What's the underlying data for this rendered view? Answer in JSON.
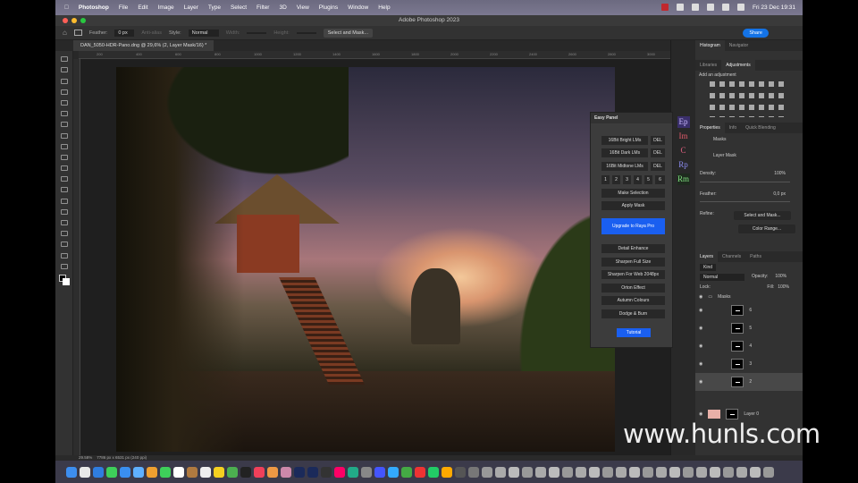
{
  "menubar": {
    "app": "Photoshop",
    "items": [
      "File",
      "Edit",
      "Image",
      "Layer",
      "Type",
      "Select",
      "Filter",
      "3D",
      "View",
      "Plugins",
      "Window",
      "Help"
    ],
    "clock": "Fri 23 Dec  19:31"
  },
  "window": {
    "title": "Adobe Photoshop 2023"
  },
  "options": {
    "feather_label": "Feather:",
    "feather_value": "0 px",
    "anti_alias": "Anti-alias",
    "style_label": "Style:",
    "style_value": "Normal",
    "width_label": "Width:",
    "height_label": "Height:",
    "select_mask": "Select and Mask...",
    "share": "Share"
  },
  "document": {
    "tab": "DAN_5050-HDR-Pano.dng @ 29,6% (2, Layer Mask/16) *",
    "zoom": "29.58%",
    "info": "7786 px x 6531 px (240 ppi)"
  },
  "ruler_ticks": [
    "200",
    "400",
    "600",
    "800",
    "1000",
    "1200",
    "1400",
    "1600",
    "1800",
    "2000",
    "2200",
    "2400",
    "2600",
    "2800",
    "3000"
  ],
  "side_icons": [
    "Ep",
    "Im",
    "C",
    "Rp",
    "Rm"
  ],
  "easy_panel": {
    "title": "Easy Panel",
    "rows": [
      {
        "label": "16Bit Bright LMs",
        "del": "DEL"
      },
      {
        "label": "16Bit Dark LMs",
        "del": "DEL"
      },
      {
        "label": "16Bit Midtone LMs",
        "del": "DEL"
      }
    ],
    "numbers": [
      "1",
      "2",
      "3",
      "4",
      "5",
      "6"
    ],
    "make_selection": "Make Selection",
    "apply_mask": "Apply Mask",
    "upgrade": "Upgrade to Raya Pro",
    "actions": [
      "Detail Enhance",
      "Sharpen Full Size",
      "Sharpen For Web 2048px",
      "Orton Effect",
      "Autumn Colours",
      "Dodge & Burn"
    ],
    "tutorial": "Tutorial"
  },
  "panels": {
    "tabs1": [
      "Histogram",
      "Navigator"
    ],
    "tabs2": [
      "Libraries",
      "Adjustments"
    ],
    "add_adjustment": "Add an adjustment",
    "tabs3": [
      "Properties",
      "Info",
      "Quick Blending"
    ],
    "masks": "Masks",
    "layer_mask": "Layer Mask",
    "density_label": "Density:",
    "density": "100%",
    "feather_label": "Feather:",
    "feather": "0,0 px",
    "refine": "Refine:",
    "select_mask": "Select and Mask...",
    "color_range": "Color Range..."
  },
  "layers": {
    "tabs": [
      "Layers",
      "Channels",
      "Paths"
    ],
    "kind": "Kind",
    "blend": "Normal",
    "opacity_label": "Opacity:",
    "opacity": "100%",
    "lock_label": "Lock:",
    "fill_label": "Fill:",
    "fill": "100%",
    "group": "Masks",
    "items": [
      "6",
      "5",
      "4",
      "3",
      "2"
    ],
    "bottom": "Layer 0"
  },
  "watermark": "www.hunls.com"
}
